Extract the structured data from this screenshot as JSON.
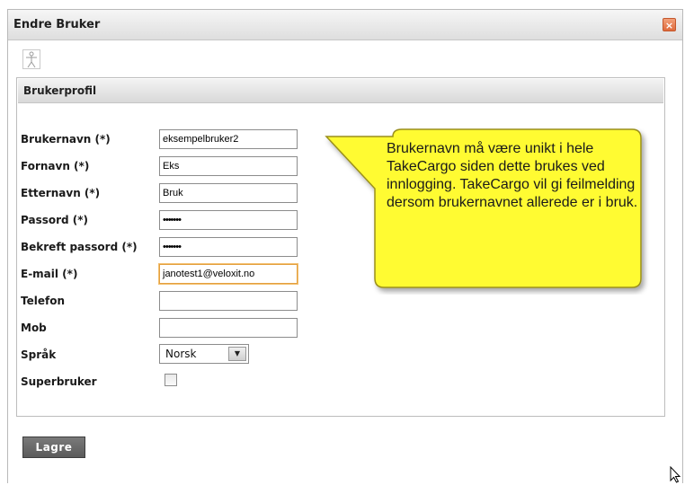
{
  "dialog": {
    "title": "Endre Bruker",
    "close_symbol": "×"
  },
  "icons": {
    "accessibility": "accessibility-icon",
    "close": "close-icon",
    "dropdown": "chevron-down-icon",
    "cursor": "mouse-cursor-icon"
  },
  "profile": {
    "section_title": "Brukerprofil",
    "fields": {
      "username": {
        "label": "Brukernavn (*)",
        "value": "eksempelbruker2"
      },
      "firstname": {
        "label": "Fornavn (*)",
        "value": "Eks"
      },
      "lastname": {
        "label": "Etternavn (*)",
        "value": "Bruk"
      },
      "password": {
        "label": "Passord (*)",
        "value": "•••••••"
      },
      "confirm_password": {
        "label": "Bekreft passord (*)",
        "value": "•••••••"
      },
      "email": {
        "label": "E-mail (*)",
        "value": "janotest1@veloxit.no"
      },
      "phone": {
        "label": "Telefon",
        "value": ""
      },
      "mobile": {
        "label": "Mob",
        "value": ""
      },
      "language": {
        "label": "Språk",
        "value": "Norsk"
      },
      "superuser": {
        "label": "Superbruker",
        "checked": false
      }
    }
  },
  "tooltip": {
    "text": "Brukernavn må være unikt i hele TakeCargo siden dette brukes ved innlogging. TakeCargo vil gi feilmelding dersom brukernavnet allerede er i bruk."
  },
  "actions": {
    "save_label": "Lagre"
  },
  "colors": {
    "tooltip_fill": "#fffb33",
    "tooltip_border": "#9a8f1a",
    "focus_border": "#e3a040",
    "close_button": "#df6a3c"
  }
}
